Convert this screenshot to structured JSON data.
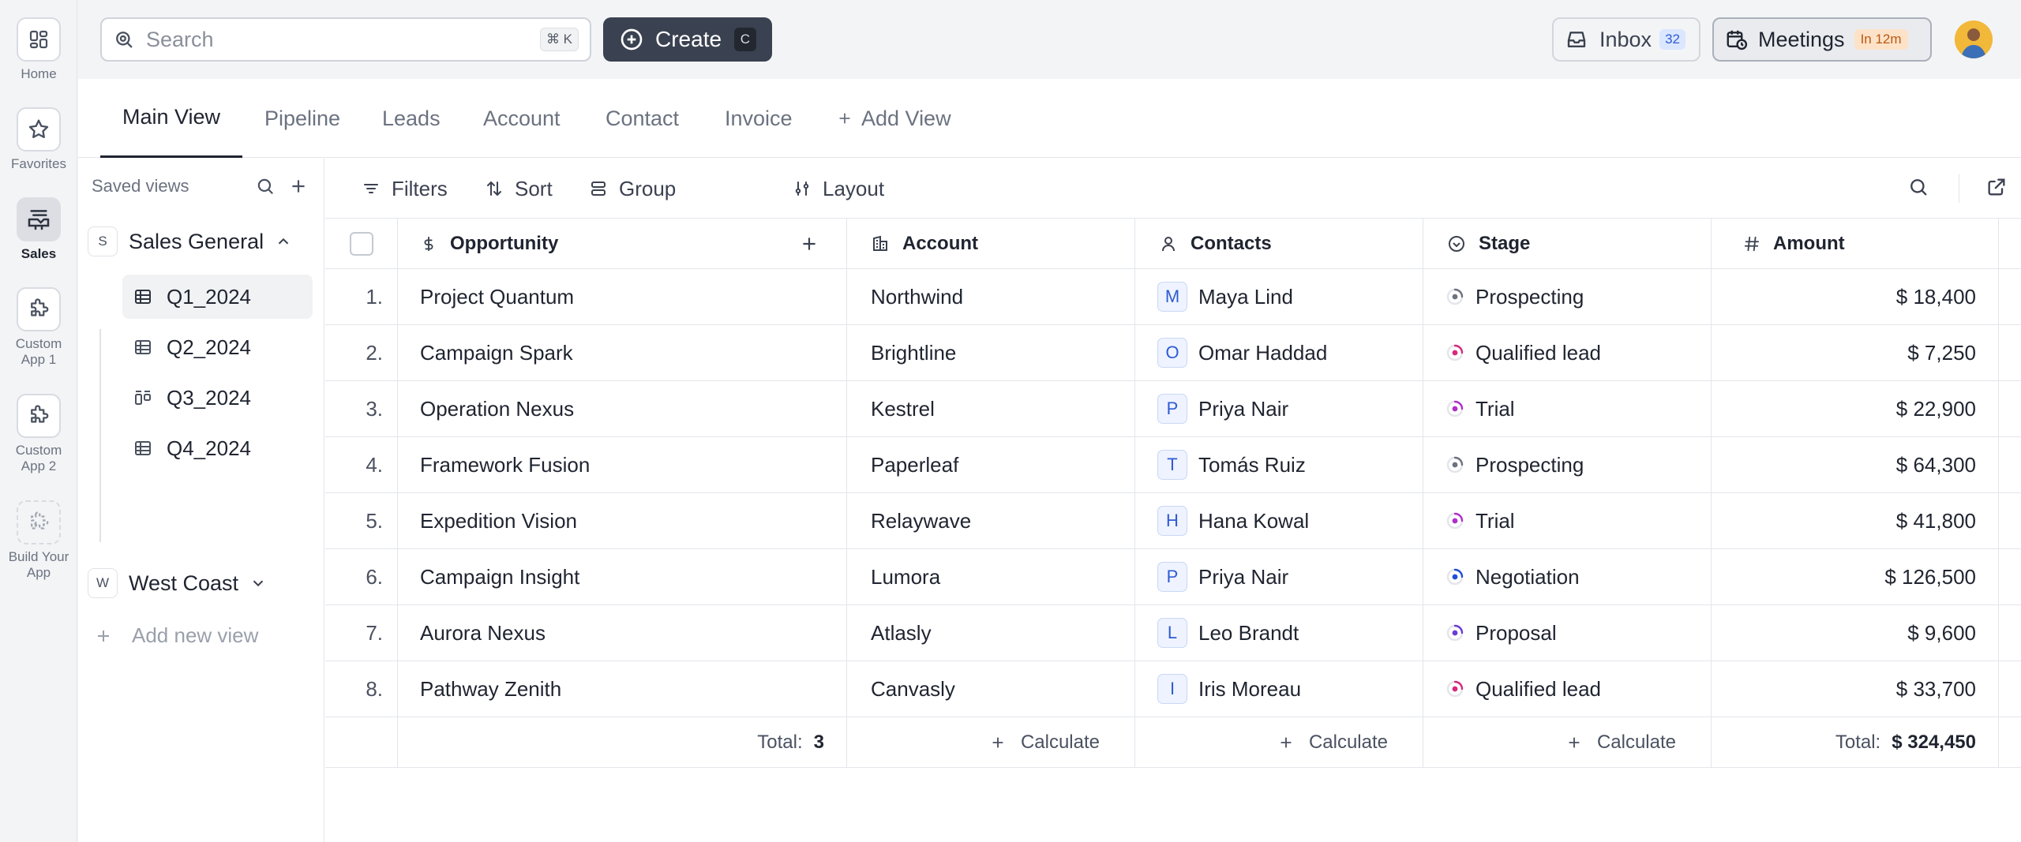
{
  "rail": [
    {
      "label": "Home",
      "icon": "grid-icon"
    },
    {
      "label": "Favorites",
      "icon": "star-icon"
    },
    {
      "label": "Sales",
      "icon": "handshake-icon",
      "active": true
    },
    {
      "label": "Custom App 1",
      "icon": "puzzle-icon"
    },
    {
      "label": "Custom App 2",
      "icon": "puzzle-icon"
    },
    {
      "label": "Build Your App",
      "icon": "puzzle-add-icon"
    }
  ],
  "topbar": {
    "search_placeholder": "Search",
    "search_shortcut": "⌘ K",
    "create_label": "Create",
    "create_shortcut": "C",
    "inbox_label": "Inbox",
    "inbox_count": "32",
    "meetings_label": "Meetings",
    "meetings_badge": "In 12m"
  },
  "view_tabs": [
    "Main View",
    "Pipeline",
    "Leads",
    "Account",
    "Contact",
    "Invoice"
  ],
  "add_view_label": "Add View",
  "saved_views": {
    "header": "Saved views",
    "groups": [
      {
        "chip": "S",
        "name": "Sales General",
        "views": [
          "Q1_2024",
          "Q2_2024",
          "Q3_2024",
          "Q4_2024"
        ]
      },
      {
        "chip": "W",
        "name": "West Coast"
      }
    ],
    "add_label": "Add new view"
  },
  "toolbar": {
    "filters": "Filters",
    "sort": "Sort",
    "group": "Group",
    "layout": "Layout"
  },
  "table": {
    "headers": [
      "Opportunity",
      "Account",
      "Contacts",
      "Stage",
      "Amount"
    ],
    "rows": [
      {
        "n": "1.",
        "opp": "Project Quantum",
        "account": "Northwind",
        "contact": "Maya Lind",
        "initial": "M",
        "stage": "Prospecting",
        "amount": "$ 18,400"
      },
      {
        "n": "2.",
        "opp": "Campaign Spark",
        "account": "Brightline",
        "contact": "Omar Haddad",
        "initial": "O",
        "stage": "Qualified lead",
        "amount": "$ 7,250"
      },
      {
        "n": "3.",
        "opp": "Operation Nexus",
        "account": "Kestrel",
        "contact": "Priya Nair",
        "initial": "P",
        "stage": "Trial",
        "amount": "$ 22,900"
      },
      {
        "n": "4.",
        "opp": "Framework Fusion",
        "account": "Paperleaf",
        "contact": "Tomás Ruiz",
        "initial": "T",
        "stage": "Prospecting",
        "amount": "$ 64,300"
      },
      {
        "n": "5.",
        "opp": "Expedition Vision",
        "account": "Relaywave",
        "contact": "Hana Kowal",
        "initial": "H",
        "stage": "Trial",
        "amount": "$ 41,800"
      },
      {
        "n": "6.",
        "opp": "Campaign Insight",
        "account": "Lumora",
        "contact": "Priya Nair",
        "initial": "P",
        "stage": "Negotiation",
        "amount": "$ 126,500"
      },
      {
        "n": "7.",
        "opp": "Aurora Nexus",
        "account": "Atlasly",
        "contact": "Leo Brandt",
        "initial": "L",
        "stage": "Proposal",
        "amount": "$ 9,600"
      },
      {
        "n": "8.",
        "opp": "Pathway Zenith",
        "account": "Canvasly",
        "contact": "Iris Moreau",
        "initial": "I",
        "stage": "Qualified lead",
        "amount": "$ 33,700"
      }
    ],
    "footer": {
      "total_label": "Total:",
      "opp_total": "3",
      "calculate_label": "Calculate",
      "amount_total": "$ 324,450"
    }
  },
  "stage_colors": {
    "Prospecting": "#6b7280",
    "Qualified lead": "#d6287f",
    "Trial": "#b02fc9",
    "Negotiation": "#1f4fd6",
    "Proposal": "#6b3ad6"
  }
}
